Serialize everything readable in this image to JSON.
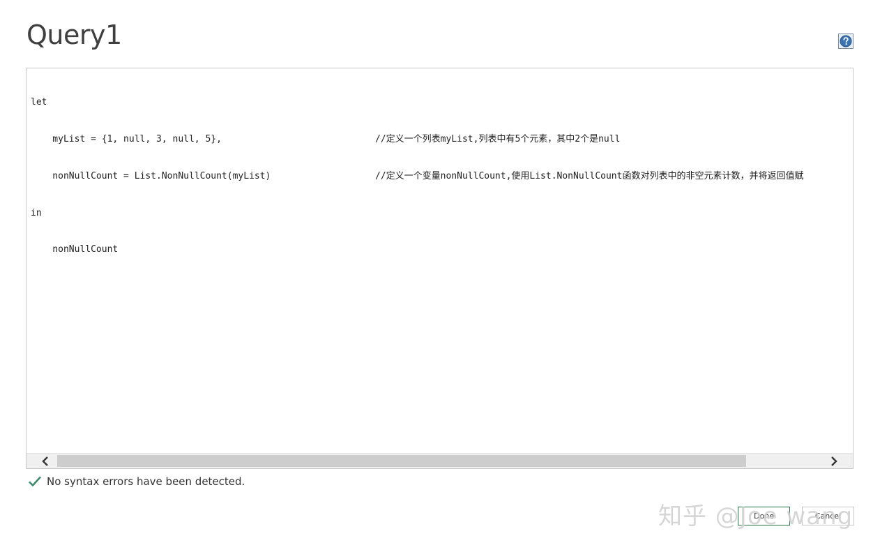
{
  "window": {
    "title": "Query1"
  },
  "editor": {
    "lines": [
      {
        "code": "let",
        "comment": ""
      },
      {
        "code": "    myList = {1, null, 3, null, 5},",
        "comment": "//定义一个列表myList,列表中有5个元素，其中2个是null"
      },
      {
        "code": "    nonNullCount = List.NonNullCount(myList)",
        "comment": "//定义一个变量nonNullCount,使用List.NonNullCount函数对列表中的非空元素计数，并将返回值赋"
      },
      {
        "code": "in",
        "comment": ""
      },
      {
        "code": "    nonNullCount",
        "comment": ""
      }
    ]
  },
  "status": {
    "message": "No syntax errors have been detected.",
    "icon": "checkmark-icon",
    "color": "#3c8a6a"
  },
  "buttons": {
    "done_label": "Done",
    "cancel_label": "Cancel"
  },
  "watermark": {
    "text": "知乎 @Joe wang"
  },
  "colors": {
    "accent": "#217346",
    "help": "#3a74b3"
  }
}
